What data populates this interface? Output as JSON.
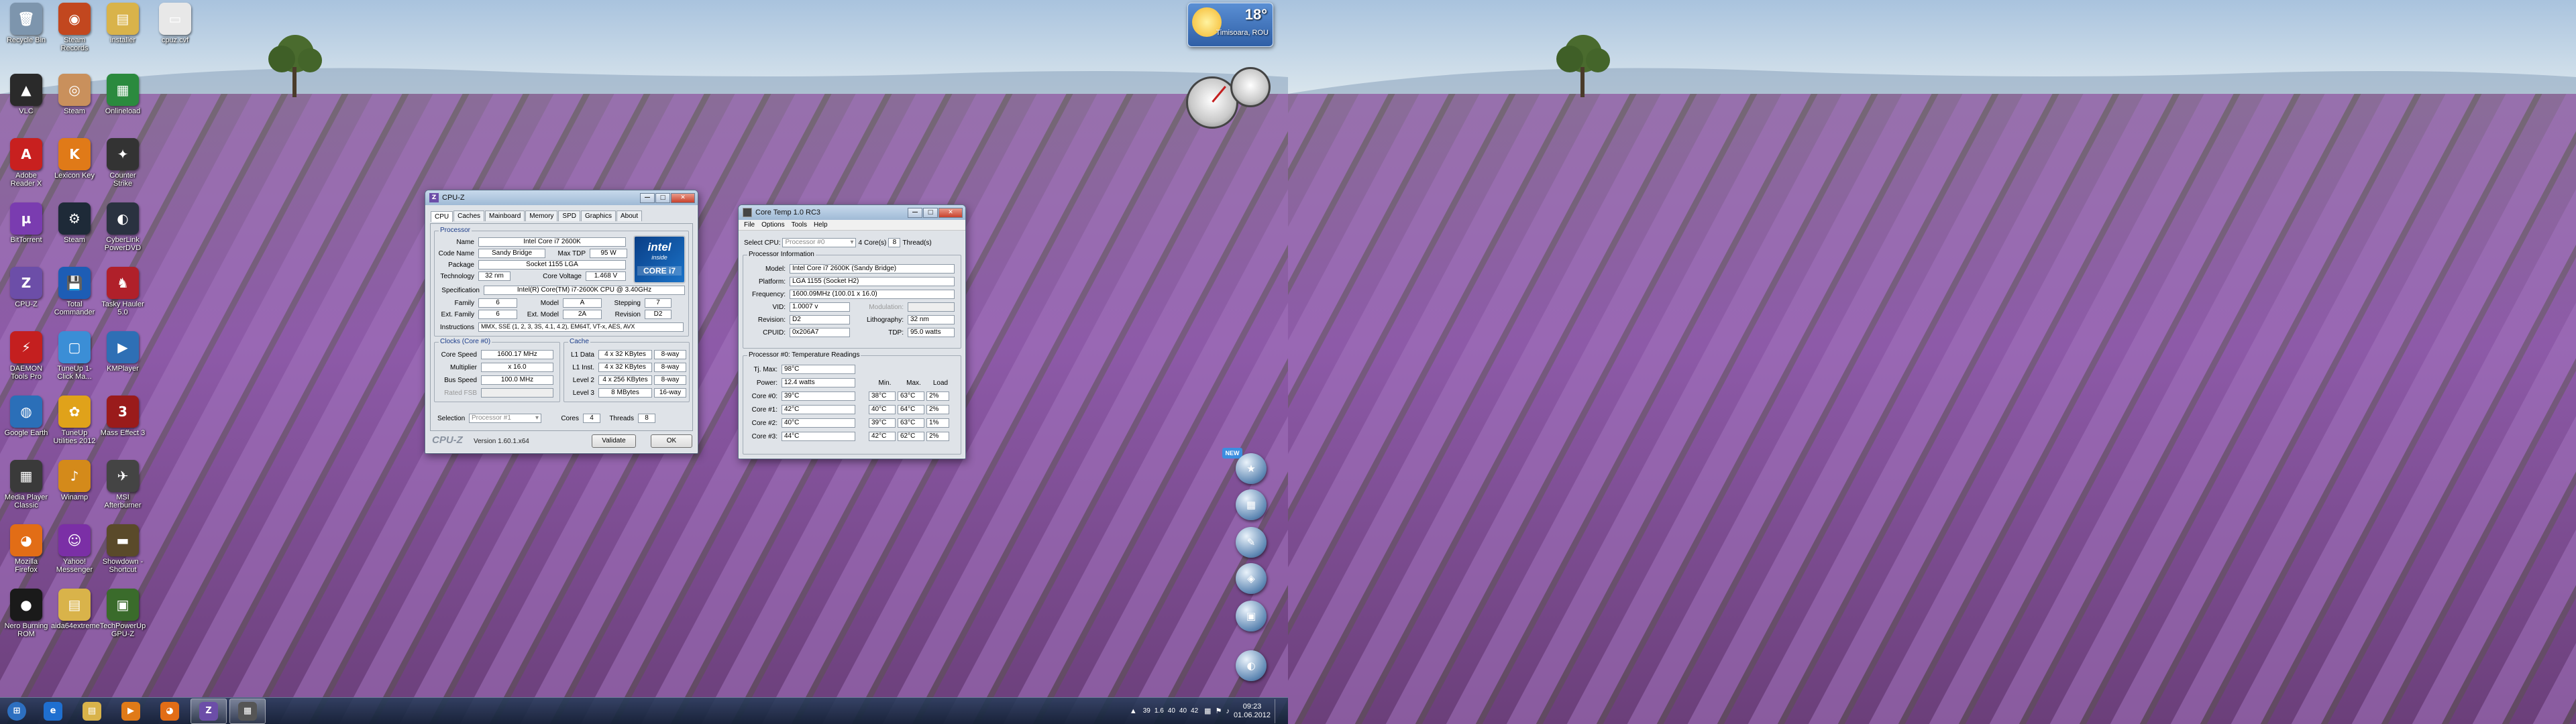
{
  "desktop": {
    "icons": [
      {
        "label": "Recycle Bin",
        "glyph": "🗑",
        "color": "#7d95ad",
        "icon": "recycle-bin-icon"
      },
      {
        "label": "Steam Records",
        "glyph": "◉",
        "color": "#c2471f",
        "icon": "steam-records-icon"
      },
      {
        "label": "installer",
        "glyph": "▤",
        "color": "#d9b34a",
        "icon": "folder-icon"
      },
      {
        "label": "cpuz.cvf",
        "glyph": "▭",
        "color": "#e8e8e8",
        "icon": "file-icon"
      },
      {
        "label": "VLC",
        "glyph": "▲",
        "color": "#2a2a2a",
        "icon": "vlc-icon"
      },
      {
        "label": "Steam",
        "glyph": "◎",
        "color": "#c9905c",
        "icon": "steam-icon"
      },
      {
        "label": "Onlineload",
        "glyph": "▦",
        "color": "#2b8a3e",
        "icon": "app-icon"
      },
      {
        "label": "Adobe Reader X",
        "glyph": "A",
        "color": "#c8201f",
        "icon": "adobe-reader-icon"
      },
      {
        "label": "Lexicon Key",
        "glyph": "K",
        "color": "#e07a18",
        "icon": "app-icon"
      },
      {
        "label": "Counter Strike",
        "glyph": "✦",
        "color": "#333333",
        "icon": "game-icon"
      },
      {
        "label": "BitTorrent",
        "glyph": "µ",
        "color": "#7a3cb0",
        "icon": "bittorrent-icon"
      },
      {
        "label": "Steam",
        "glyph": "⚙",
        "color": "#1e2a38",
        "icon": "steam-icon"
      },
      {
        "label": "CyberLink PowerDVD",
        "glyph": "◐",
        "color": "#2a3240",
        "icon": "powerdvd-icon"
      },
      {
        "label": "CPU-Z",
        "glyph": "Z",
        "color": "#6c4ea8",
        "icon": "cpuz-icon"
      },
      {
        "label": "Total Commander",
        "glyph": "💾",
        "color": "#1d5db5",
        "icon": "floppy-icon"
      },
      {
        "label": "Tasky Hauler 5.0",
        "glyph": "♞",
        "color": "#b0202a",
        "icon": "app-icon"
      },
      {
        "label": "DAEMON Tools Pro",
        "glyph": "⚡",
        "color": "#c41f1f",
        "icon": "daemon-tools-icon"
      },
      {
        "label": "TuneUp 1-Click Ma...",
        "glyph": "▢",
        "color": "#3b8ed6",
        "icon": "tuneup-icon"
      },
      {
        "label": "KMPlayer",
        "glyph": "▶",
        "color": "#2e6fb5",
        "icon": "kmplayer-icon"
      },
      {
        "label": "Google Earth",
        "glyph": "◍",
        "color": "#2b6fb8",
        "icon": "google-earth-icon"
      },
      {
        "label": "TuneUp Utilities 2012",
        "glyph": "✿",
        "color": "#e0a21a",
        "icon": "tuneup-icon"
      },
      {
        "label": "Mass Effect 3",
        "glyph": "3",
        "color": "#9a1b1b",
        "icon": "game-icon"
      },
      {
        "label": "Media Player Classic",
        "glyph": "▦",
        "color": "#3a3a3a",
        "icon": "media-player-icon"
      },
      {
        "label": "Winamp",
        "glyph": "♪",
        "color": "#d48a1a",
        "icon": "winamp-icon"
      },
      {
        "label": "MSI Afterburner",
        "glyph": "✈",
        "color": "#444444",
        "icon": "afterburner-icon"
      },
      {
        "label": "Mozilla Firefox",
        "glyph": "◕",
        "color": "#e26d16",
        "icon": "firefox-icon"
      },
      {
        "label": "Yahoo! Messenger",
        "glyph": "☺",
        "color": "#7b2fa6",
        "icon": "messenger-icon"
      },
      {
        "label": "Showdown - Shortcut",
        "glyph": "▬",
        "color": "#5a4a2a",
        "icon": "shortcut-icon"
      },
      {
        "label": "Nero Burning ROM",
        "glyph": "●",
        "color": "#1a1a1a",
        "icon": "nero-icon"
      },
      {
        "label": "aida64extreme",
        "glyph": "▤",
        "color": "#d9b34a",
        "icon": "folder-icon"
      },
      {
        "label": "TechPowerUp GPU-Z",
        "glyph": "▣",
        "color": "#3a6b2b",
        "icon": "gpuz-icon"
      }
    ],
    "weather": {
      "temp": "18°",
      "location": "Timisoara, ROU"
    }
  },
  "cpuz": {
    "title": "CPU-Z",
    "tabs": [
      "CPU",
      "Caches",
      "Mainboard",
      "Memory",
      "SPD",
      "Graphics",
      "About"
    ],
    "processor_group": "Processor",
    "labels": {
      "name": "Name",
      "code_name": "Code Name",
      "max_tdp": "Max TDP",
      "package": "Package",
      "technology": "Technology",
      "core_voltage": "Core Voltage",
      "specification": "Specification",
      "family": "Family",
      "model": "Model",
      "stepping": "Stepping",
      "ext_family": "Ext. Family",
      "ext_model": "Ext. Model",
      "revision": "Revision",
      "instructions": "Instructions"
    },
    "values": {
      "name": "Intel Core i7 2600K",
      "code_name": "Sandy Bridge",
      "max_tdp": "95 W",
      "package": "Socket 1155 LGA",
      "technology": "32 nm",
      "core_voltage": "1.468 V",
      "specification": "Intel(R) Core(TM) i7-2600K CPU @ 3.40GHz",
      "family": "6",
      "model": "A",
      "stepping": "7",
      "ext_family": "6",
      "ext_model": "2A",
      "revision": "D2",
      "instructions": "MMX, SSE (1, 2, 3, 3S, 4.1, 4.2), EM64T, VT-x, AES, AVX"
    },
    "clocks_group": "Clocks (Core #0)",
    "clocks": [
      {
        "label": "Core Speed",
        "value": "1600.17 MHz"
      },
      {
        "label": "Multiplier",
        "value": "x 16.0"
      },
      {
        "label": "Bus Speed",
        "value": "100.0 MHz"
      },
      {
        "label": "Rated FSB",
        "value": ""
      }
    ],
    "cache_group": "Cache",
    "cache": [
      {
        "label": "L1 Data",
        "size": "4 x 32 KBytes",
        "way": "8-way"
      },
      {
        "label": "L1 Inst.",
        "size": "4 x 32 KBytes",
        "way": "8-way"
      },
      {
        "label": "Level 2",
        "size": "4 x 256 KBytes",
        "way": "8-way"
      },
      {
        "label": "Level 3",
        "size": "8 MBytes",
        "way": "16-way"
      }
    ],
    "selection_label": "Selection",
    "selection_value": "Processor #1",
    "cores_label": "Cores",
    "cores_value": "4",
    "threads_label": "Threads",
    "threads_value": "8",
    "brand": "CPU-Z",
    "version": "Version 1.60.1.x64",
    "validate": "Validate",
    "ok": "OK",
    "badge": {
      "top": "intel",
      "sub": "inside",
      "core": "CORE i7"
    }
  },
  "coretemp": {
    "title": "Core Temp 1.0 RC3",
    "menu": [
      "File",
      "Options",
      "Tools",
      "Help"
    ],
    "select_cpu_label": "Select CPU:",
    "select_cpu_value": "Processor #0",
    "cores_count": "4",
    "cores_label": "Core(s)",
    "threads_count": "8",
    "threads_label": "Thread(s)",
    "info_group": "Processor Information",
    "model_label": "Model:",
    "model_value": "Intel Core i7 2600K (Sandy Bridge)",
    "platform_label": "Platform:",
    "platform_value": "LGA 1155 (Socket H2)",
    "frequency_label": "Frequency:",
    "frequency_value": "1600.09MHz (100.01 x 16.0)",
    "vid_label": "VID:",
    "vid_value": "1.0007 v",
    "modulation_label": "Modulation:",
    "revision_label": "Revision:",
    "revision_value": "D2",
    "lithography_label": "Lithography:",
    "lithography_value": "32 nm",
    "cpuid_label": "CPUID:",
    "cpuid_value": "0x206A7",
    "tdp_label": "TDP:",
    "tdp_value": "95.0 watts",
    "temps_group": "Processor #0: Temperature Readings",
    "tjmax_label": "Tj. Max:",
    "tjmax_value": "98°C",
    "power_label": "Power:",
    "power_value": "12.4 watts",
    "col_min": "Min.",
    "col_max": "Max.",
    "col_load": "Load",
    "cores": [
      {
        "label": "Core #0:",
        "temp": "39°C",
        "min": "38°C",
        "max": "63°C",
        "load": "2%"
      },
      {
        "label": "Core #1:",
        "temp": "42°C",
        "min": "40°C",
        "max": "64°C",
        "load": "2%"
      },
      {
        "label": "Core #2:",
        "temp": "40°C",
        "min": "39°C",
        "max": "63°C",
        "load": "1%"
      },
      {
        "label": "Core #3:",
        "temp": "44°C",
        "min": "42°C",
        "max": "62°C",
        "load": "2%"
      }
    ]
  },
  "taskbar": {
    "items": [
      {
        "glyph": "⊞",
        "color": "#2d6fc0",
        "icon": "start-orb-icon"
      },
      {
        "glyph": "e",
        "color": "#1f6fd0",
        "icon": "internet-explorer-icon"
      },
      {
        "glyph": "▤",
        "color": "#d9b34a",
        "icon": "explorer-folder-icon"
      },
      {
        "glyph": "▶",
        "color": "#e07a18",
        "icon": "media-player-icon"
      },
      {
        "glyph": "◕",
        "color": "#e26d16",
        "icon": "firefox-icon"
      },
      {
        "glyph": "Z",
        "color": "#6c4ea8",
        "icon": "cpuz-icon",
        "active": true
      },
      {
        "glyph": "▦",
        "color": "#555",
        "icon": "coretemp-icon",
        "active": true
      }
    ],
    "tray_temps": [
      "39",
      "1.6",
      "40",
      "40",
      "42"
    ],
    "time": "09:23",
    "date": "01.06.2012"
  },
  "colors": {
    "accent": "#2d6fc0",
    "core_temp_title": "#9fbad6",
    "lavender": "#8a5fa5"
  }
}
